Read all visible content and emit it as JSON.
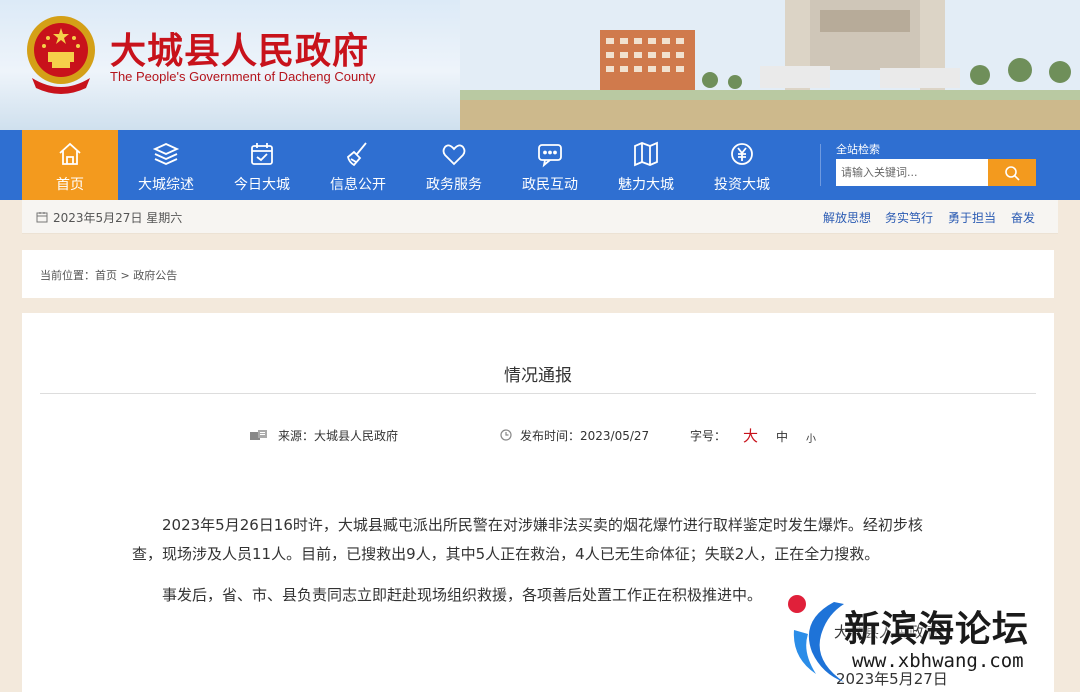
{
  "header": {
    "site_name_cn": "大城县人民政府",
    "site_name_en": "The People's Government of Dacheng County",
    "emblem_icon": "national-emblem-icon"
  },
  "nav": {
    "items": [
      {
        "label": "首页",
        "icon": "home-icon",
        "active": true
      },
      {
        "label": "大城综述",
        "icon": "layers-icon",
        "active": false
      },
      {
        "label": "今日大城",
        "icon": "calendar-check-icon",
        "active": false
      },
      {
        "label": "信息公开",
        "icon": "broom-icon",
        "active": false
      },
      {
        "label": "政务服务",
        "icon": "heart-icon",
        "active": false
      },
      {
        "label": "政民互动",
        "icon": "chat-icon",
        "active": false
      },
      {
        "label": "魅力大城",
        "icon": "map-icon",
        "active": false
      },
      {
        "label": "投资大城",
        "icon": "yuan-icon",
        "active": false
      }
    ],
    "search_title": "全站检索",
    "search_placeholder": "请输入关键词...",
    "accent_color": "#2f6fd1",
    "active_color": "#f39a1e"
  },
  "datebar": {
    "date": "2023年5月27日 星期六",
    "slogans": [
      "解放思想",
      "务实笃行",
      "勇于担当",
      "奋发"
    ]
  },
  "breadcrumb": {
    "prefix": "当前位置：",
    "home": "首页",
    "sep": " > ",
    "current": "政府公告"
  },
  "article": {
    "title": "情况通报",
    "source_label": "来源：大城县人民政府",
    "publish_label": "发布时间：2023/05/27",
    "font_size_label": "字号：",
    "font_sizes": [
      "大",
      "中",
      "小"
    ],
    "paragraphs": [
      "2023年5月26日16时许，大城县臧屯派出所民警在对涉嫌非法买卖的烟花爆竹进行取样鉴定时发生爆炸。经初步核查，现场涉及人员11人。目前，已搜救出9人，其中5人正在救治，4人已无生命体征；失联2人，正在全力搜救。",
      "事发后，省、市、县负责同志立即赶赴现场组织救援，各项善后处置工作正在积极推进中。"
    ],
    "signature": "大城县人民政府",
    "sign_date": "2023年5月27日"
  },
  "watermark": {
    "name": "新滨海论坛",
    "url": "www.xbhwang.com"
  }
}
